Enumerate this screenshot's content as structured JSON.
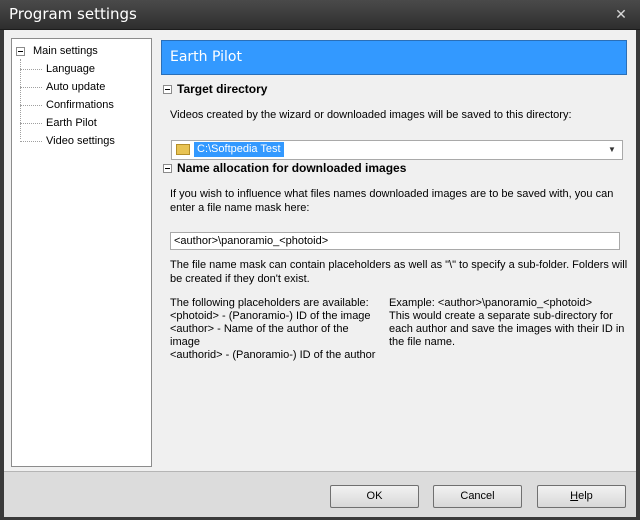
{
  "window": {
    "title": "Program settings",
    "close_glyph": "✕"
  },
  "tree": {
    "root": "Main settings",
    "items": [
      "Language",
      "Auto update",
      "Confirmations",
      "Earth Pilot",
      "Video settings"
    ],
    "selected": "Earth Pilot"
  },
  "panel": {
    "header": "Earth Pilot",
    "section1": {
      "title": "Target directory",
      "description": "Videos created by the wizard or downloaded images will be saved to this directory:",
      "directory": "C:\\Softpedia Test"
    },
    "section2": {
      "title": "Name allocation for downloaded images",
      "intro_line1": "If you wish to influence what files names downloaded images are to be saved with, you can",
      "intro_line2": "enter a file name mask here:",
      "mask": "<author>\\panoramio_<photoid>",
      "note_line1": "The file name mask can contain placeholders as well as \"\\\" to specify a sub-folder. Folders will",
      "note_line2": "be created if they don't exist.",
      "placeholders": [
        "The following placeholders are available:",
        "<photoid> -  (Panoramio-) ID of the image",
        "<author> - Name of the author of the",
        "image",
        "<authorid> - (Panoramio-) ID of the author"
      ],
      "example": [
        "Example: <author>\\panoramio_<photoid>",
        "This would create a separate sub-directory for",
        "each author and save the images with their ID in",
        "the file name."
      ]
    }
  },
  "buttons": {
    "ok": "OK",
    "cancel": "Cancel",
    "help_accel": "H",
    "help_rest": "elp"
  },
  "colors": {
    "accent": "#3399ff",
    "titlebar": "#3a3a3a",
    "dialog_bg": "#f0f0f0"
  },
  "icons": {
    "folder": "folder-icon",
    "dropdown": "chevron-down-icon",
    "collapse": "minus-box-icon"
  }
}
